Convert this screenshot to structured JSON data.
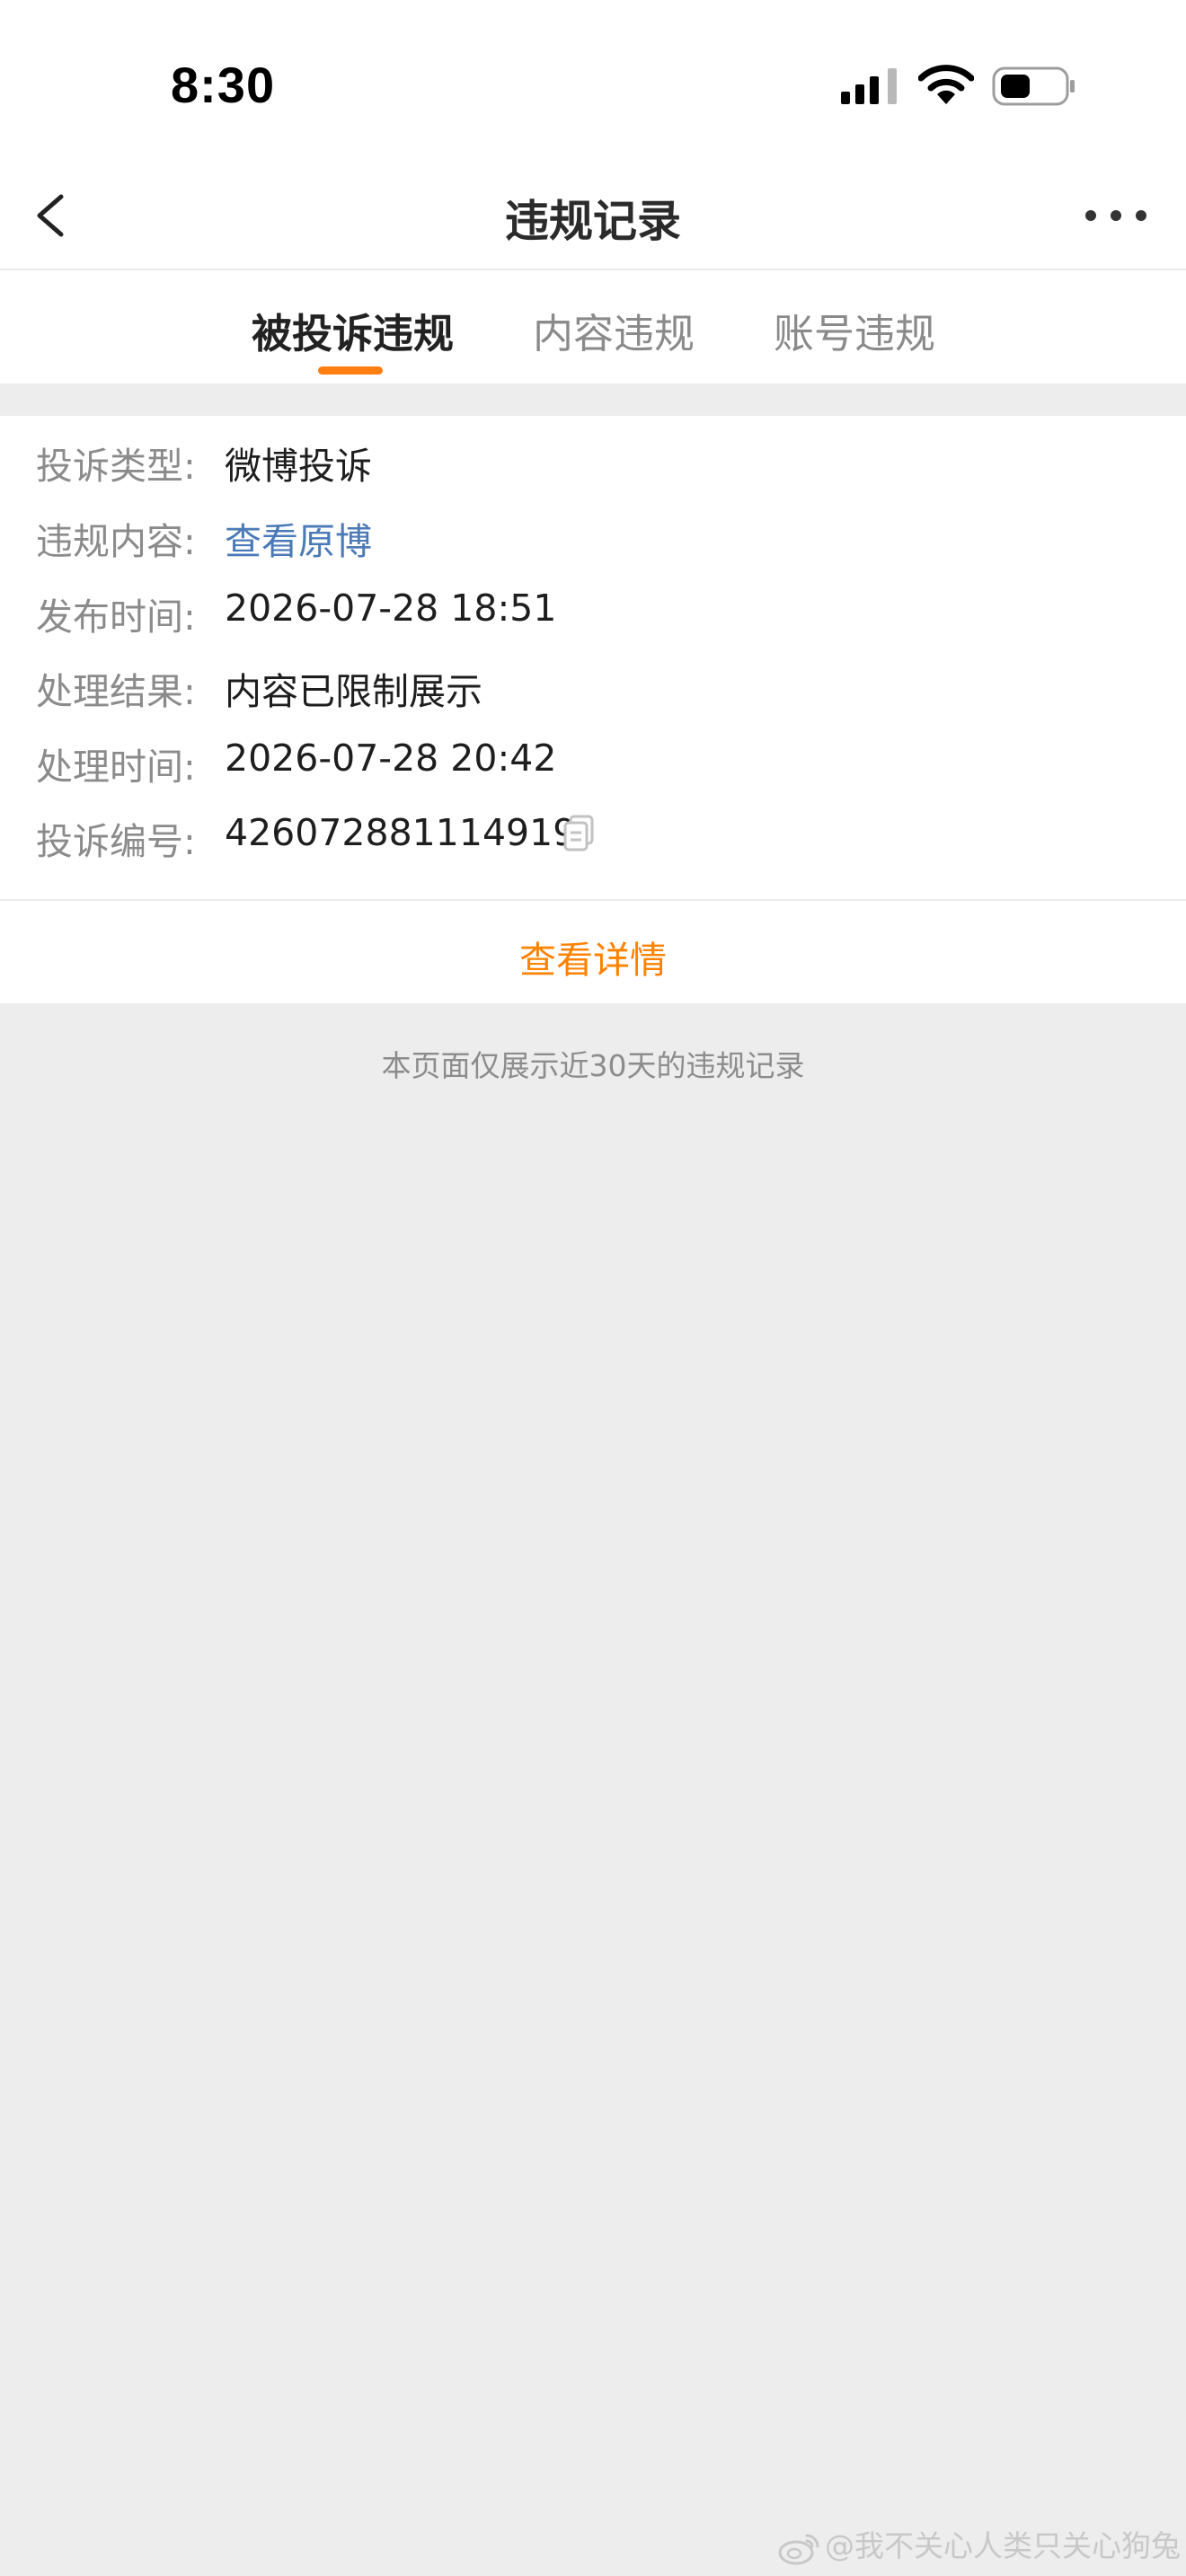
{
  "status_bar": {
    "time": "8:30",
    "icons": [
      "signal-icon",
      "wifi-icon",
      "battery-icon"
    ]
  },
  "nav": {
    "title": "违规记录",
    "back_icon": "chevron-left-icon",
    "more_icon": "more-horizontal-icon"
  },
  "tabs": [
    {
      "label": "被投诉违规",
      "active": true
    },
    {
      "label": "内容违规",
      "active": false
    },
    {
      "label": "账号违规",
      "active": false
    }
  ],
  "record": {
    "rows": [
      {
        "label": "投诉类型:",
        "value": "微博投诉"
      },
      {
        "label": "违规内容:",
        "value": "查看原博"
      },
      {
        "label": "发布时间:",
        "value": "2026-07-28 18:51"
      },
      {
        "label": "处理结果:",
        "value": "内容已限制展示"
      },
      {
        "label": "处理时间:",
        "value": "2026-07-28 20:42"
      },
      {
        "label": "投诉编号:",
        "value": "426072881114919"
      }
    ],
    "details_label": "查看详情"
  },
  "footer_note": "本页面仅展示近30天的违规记录",
  "watermark": "@我不关心人类只关心狗兔",
  "colors": {
    "accent": "#ff7e12",
    "link": "#4a7ab7",
    "page_background": "#ededed"
  }
}
